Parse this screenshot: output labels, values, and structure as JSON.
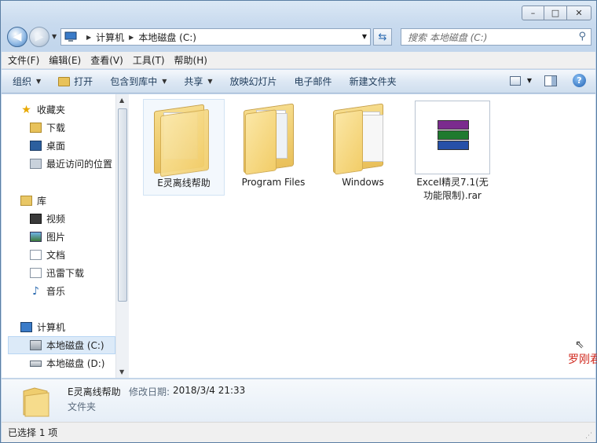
{
  "window": {
    "controls": {
      "minimize": "–",
      "maximize": "□",
      "close": "✕"
    }
  },
  "address": {
    "crumbs": [
      "计算机",
      "本地磁盘 (C:)"
    ],
    "search_placeholder": "搜索 本地磁盘 (C:)"
  },
  "menubar": [
    "文件(F)",
    "编辑(E)",
    "查看(V)",
    "工具(T)",
    "帮助(H)"
  ],
  "commandbar": {
    "organize": "组织",
    "open": "打开",
    "include_library": "包含到库中",
    "share": "共享",
    "slideshow": "放映幻灯片",
    "email": "电子邮件",
    "new_folder": "新建文件夹",
    "help": "?"
  },
  "navpane": {
    "favorites": {
      "title": "收藏夹",
      "items": [
        "下载",
        "桌面",
        "最近访问的位置"
      ]
    },
    "libraries": {
      "title": "库",
      "items": [
        "视频",
        "图片",
        "文档",
        "迅雷下载",
        "音乐"
      ]
    },
    "computer": {
      "title": "计算机",
      "items": [
        "本地磁盘 (C:)",
        "本地磁盘 (D:)"
      ]
    }
  },
  "files": [
    {
      "name": "E灵离线帮助",
      "type": "folder",
      "selected": true
    },
    {
      "name": "Program Files",
      "type": "folder",
      "selected": false
    },
    {
      "name": "Windows",
      "type": "folder",
      "selected": false
    },
    {
      "name": "Excel精灵7.1(无功能限制).rar",
      "name_line1": "Excel精灵7.1(无",
      "name_line2": "功能限制).rar",
      "type": "rar",
      "selected": false
    }
  ],
  "details": {
    "name": "E灵离线帮助",
    "modified_label": "修改日期:",
    "modified_value": "2018/3/4 21:33",
    "type": "文件夹"
  },
  "statusbar": {
    "text": "已选择 1 项"
  },
  "watermark": "罗刚君"
}
